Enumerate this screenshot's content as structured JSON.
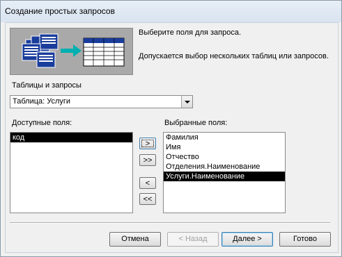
{
  "window": {
    "title": "Создание простых запросов"
  },
  "header": {
    "instruction": "Выберите поля для запроса.",
    "note": "Допускается выбор нескольких таблиц или запросов."
  },
  "source": {
    "label": "Таблицы и запросы",
    "selected": "Таблица: Услуги"
  },
  "available": {
    "label": "Доступные поля:",
    "items": [
      "код"
    ]
  },
  "selected_fields": {
    "label": "Выбранные поля:",
    "items": [
      "Фамилия",
      "Имя",
      "Отчество",
      "Отделения.Наименование",
      "Услуги.Наименование"
    ]
  },
  "move_buttons": {
    "add_one": ">",
    "add_all": ">>",
    "remove_one": "<",
    "remove_all": "<<"
  },
  "footer": {
    "cancel": "Отмена",
    "back": "< Назад",
    "next": "Далее >",
    "finish": "Готово"
  },
  "colors": {
    "selection": "#000000",
    "banner_bg": "#a9a9a9",
    "arrow": "#00b0b0"
  }
}
